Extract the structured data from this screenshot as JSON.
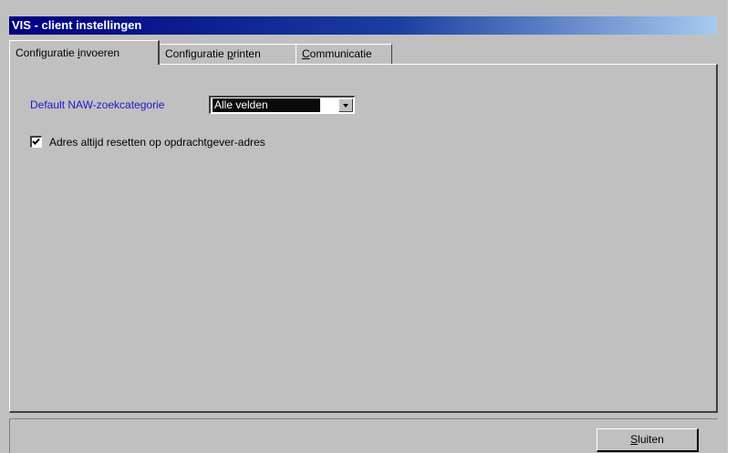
{
  "window": {
    "title": "VIS - client instellingen"
  },
  "tabs": [
    {
      "label_pre": "Configuratie ",
      "label_key": "i",
      "label_post": "nvoeren",
      "active": true
    },
    {
      "label_pre": "Configuratie ",
      "label_key": "p",
      "label_post": "rinten",
      "active": false
    },
    {
      "label_pre": "",
      "label_key": "C",
      "label_post": "ommunicatie",
      "active": false
    }
  ],
  "settings": {
    "naw_label": "Default NAW-zoekcategorie",
    "naw_value": "Alle velden",
    "reset_label": "Adres altijd resetten op opdrachtgever-adres",
    "reset_checked": true
  },
  "footer": {
    "close_key": "S",
    "close_rest": "luiten"
  },
  "colors": {
    "title_start": "#000080",
    "label_blue": "#1a1acc",
    "face": "#c0c0c0"
  }
}
